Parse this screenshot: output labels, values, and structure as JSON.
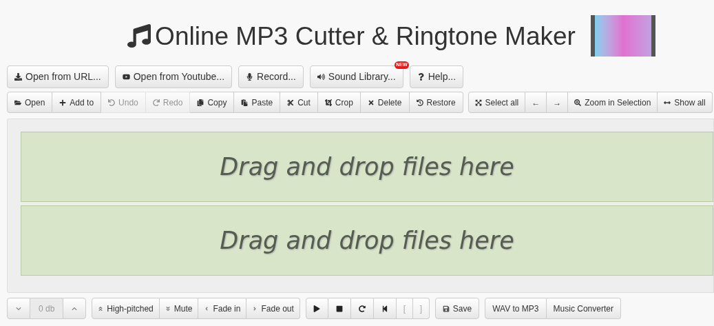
{
  "header": {
    "title": "Online MP3 Cutter & Ringtone Maker"
  },
  "top_buttons": [
    {
      "label": "Open from URL..."
    },
    {
      "label": "Open from Youtube..."
    },
    {
      "label": "Record..."
    },
    {
      "label": "Sound Library...",
      "badge": "NEW"
    },
    {
      "label": "Help..."
    }
  ],
  "edit_toolbar": [
    {
      "label": "Open",
      "disabled": false
    },
    {
      "label": "Add to",
      "disabled": false
    },
    {
      "label": "Undo",
      "disabled": true
    },
    {
      "label": "Redo",
      "disabled": true
    },
    {
      "label": "Copy",
      "disabled": false
    },
    {
      "label": "Paste",
      "disabled": false
    },
    {
      "label": "Cut",
      "disabled": false
    },
    {
      "label": "Crop",
      "disabled": false
    },
    {
      "label": "Delete",
      "disabled": false
    },
    {
      "label": "Restore",
      "disabled": false
    }
  ],
  "view_toolbar": [
    {
      "label": "Select all"
    },
    {
      "label": "←"
    },
    {
      "label": "→"
    },
    {
      "label": "Zoom in Selection"
    },
    {
      "label": "Show all"
    }
  ],
  "tracks": [
    {
      "placeholder": "Drag and drop files here"
    },
    {
      "placeholder": "Drag and drop files here"
    }
  ],
  "volume": {
    "value": "0 db"
  },
  "effects": [
    {
      "label": "High-pitched"
    },
    {
      "label": "Mute"
    },
    {
      "label": "Fade in"
    },
    {
      "label": "Fade out"
    }
  ],
  "playback": [
    {
      "kind": "icon"
    },
    {
      "kind": "icon"
    },
    {
      "kind": "icon"
    },
    {
      "kind": "icon"
    },
    {
      "kind": "text",
      "label": "[",
      "disabled": true
    },
    {
      "kind": "text",
      "label": "]",
      "disabled": true
    }
  ],
  "save_button": {
    "label": "Save"
  },
  "links": [
    {
      "label": "WAV to MP3"
    },
    {
      "label": "Music Converter"
    }
  ]
}
